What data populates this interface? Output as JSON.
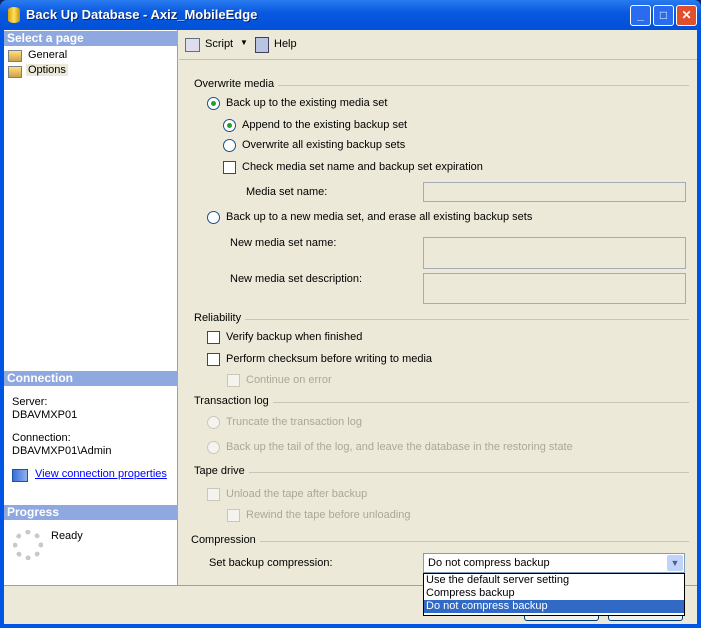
{
  "window": {
    "title": "Back Up Database - Axiz_MobileEdge",
    "minimize": "_",
    "maximize": "□",
    "close": "✕"
  },
  "left": {
    "select_page_header": "Select a page",
    "pages": [
      {
        "label": "General",
        "icon": "page-icon"
      },
      {
        "label": "Options",
        "icon": "page-icon",
        "selected": true
      }
    ],
    "connection_header": "Connection",
    "server_label": "Server:",
    "server_value": "DBAVMXP01",
    "connection_label": "Connection:",
    "connection_value": "DBAVMXP01\\Admin",
    "view_connection_link": "View connection properties",
    "progress_header": "Progress",
    "progress_status": "Ready"
  },
  "toolbar": {
    "script_label": "Script",
    "help_label": "Help"
  },
  "overwrite_media": {
    "title": "Overwrite media",
    "existing_media": "Back up to the existing media set",
    "append": "Append to the existing backup set",
    "overwrite_all": "Overwrite all existing backup sets",
    "check_media": "Check media set name and backup set expiration",
    "media_set_name_label": "Media set name:",
    "new_media": "Back up to a new media set, and erase all existing backup sets",
    "new_media_name_label": "New media set name:",
    "new_media_desc_label": "New media set description:"
  },
  "reliability": {
    "title": "Reliability",
    "verify": "Verify backup when finished",
    "checksum": "Perform checksum before writing to media",
    "continue_on_error": "Continue on error"
  },
  "transaction_log": {
    "title": "Transaction log",
    "truncate": "Truncate the transaction log",
    "tail": "Back up the tail of the log, and leave the database in the restoring state"
  },
  "tape_drive": {
    "title": "Tape drive",
    "unload": "Unload the tape after backup",
    "rewind": "Rewind the tape before unloading"
  },
  "compression": {
    "title": "Compression",
    "label": "Set backup compression:",
    "selected": "Do not compress backup",
    "options": [
      "Use the default server setting",
      "Compress backup",
      "Do not compress backup"
    ]
  }
}
